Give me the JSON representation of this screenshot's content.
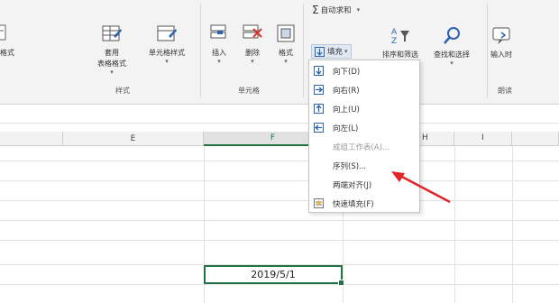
{
  "ribbon": {
    "styles_group": {
      "partial_left_label": "格式",
      "apply_table_label1": "套用",
      "apply_table_label2": "表格格式",
      "cell_style_label": "单元格样式",
      "group_label": "样式"
    },
    "cells_group": {
      "insert_label": "插入",
      "delete_label": "删除",
      "format_label": "格式",
      "group_label": "单元格"
    },
    "editing_group": {
      "autosum_label": "自动求和",
      "fill_label": "填充",
      "sort_filter_label": "排序和筛选",
      "find_select_label": "查找和选择"
    },
    "read_group": {
      "input_label": "输入时",
      "group_label": "朗读"
    }
  },
  "columns": [
    {
      "label": "E"
    },
    {
      "label": "F"
    },
    {
      "label": "H"
    },
    {
      "label": "I"
    }
  ],
  "active_cell": {
    "value": "2019/5/1"
  },
  "fill_menu": {
    "items": [
      {
        "label": "向下(D)",
        "enabled": true,
        "icon": "fill-down-icon"
      },
      {
        "label": "向右(R)",
        "enabled": true,
        "icon": "fill-right-icon"
      },
      {
        "label": "向上(U)",
        "enabled": true,
        "icon": "fill-up-icon"
      },
      {
        "label": "向左(L)",
        "enabled": true,
        "icon": "fill-left-icon"
      },
      {
        "label": "成组工作表(A)...",
        "enabled": false,
        "icon": ""
      },
      {
        "label": "序列(S)...",
        "enabled": true,
        "icon": ""
      },
      {
        "label": "两端对齐(J)",
        "enabled": true,
        "icon": ""
      },
      {
        "label": "快速填充(F)",
        "enabled": true,
        "icon": "flash-fill-icon"
      }
    ]
  },
  "colors": {
    "accent_green": "#217346",
    "annotation_arrow": "#e0262b",
    "menu_icon_blue": "#2b63b0"
  }
}
